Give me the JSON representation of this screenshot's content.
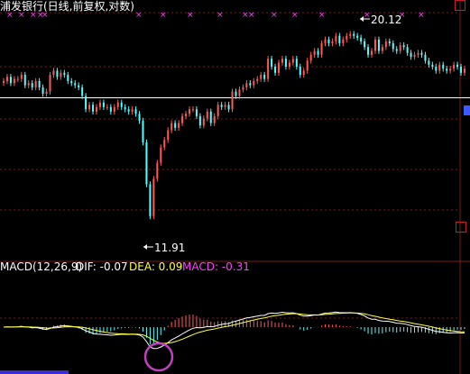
{
  "title": "浦发银行(日线,前复权,对数)",
  "colors": {
    "up": "#ff5a5a",
    "down": "#54ffff",
    "grid": "#7a1a1a",
    "baseline": "#ffffff",
    "dif": "#ffffff",
    "dea": "#ffff40",
    "macd_label": "#ff40ff",
    "marker": "#ff40ff",
    "highlight_circle": "#c040c0"
  },
  "macd_header": {
    "name": "MACD(12,26,9)",
    "dif_label": "DIF: -0.07",
    "dea_label": "DEA: 0.09",
    "macd_label": "MACD: -0.31"
  },
  "price_annotations": {
    "high": "20.12",
    "low": "11.91"
  },
  "chart_data": [
    {
      "type": "candlestick",
      "title": "浦发银行(日线,前复权,对数)",
      "scale": "log",
      "ylim": [
        10.8,
        21.2
      ],
      "annotations": {
        "max": 20.12,
        "min": 11.91
      },
      "reference_line": 16.72,
      "x": [
        1,
        2,
        3,
        4,
        5,
        6,
        7,
        8,
        9,
        10,
        11,
        12,
        13,
        14,
        15,
        16,
        17,
        18,
        19,
        20,
        21,
        22,
        23,
        24,
        25,
        26,
        27,
        28,
        29,
        30,
        31,
        32,
        33,
        34,
        35,
        36,
        37,
        38,
        39,
        40,
        41,
        42,
        43,
        44,
        45,
        46,
        47,
        48,
        49,
        50,
        51,
        52,
        53,
        54,
        55,
        56,
        57,
        58,
        59,
        60,
        61,
        62,
        63,
        64,
        65,
        66,
        67,
        68,
        69,
        70,
        71,
        72,
        73,
        74,
        75,
        76,
        77,
        78,
        79,
        80,
        81,
        82,
        83,
        84,
        85,
        86,
        87,
        88,
        89,
        90,
        91,
        92,
        93,
        94,
        95,
        96,
        97,
        98,
        99,
        100,
        101,
        102,
        103,
        104,
        105,
        106,
        107,
        108,
        109,
        110,
        111,
        112,
        113,
        114,
        115,
        116,
        117,
        118,
        119,
        120,
        121,
        122,
        123,
        124,
        125,
        126,
        127,
        128,
        129,
        130
      ],
      "close": [
        17.5,
        17.7,
        17.4,
        17.6,
        17.6,
        17.8,
        17.3,
        17.4,
        17.2,
        17.5,
        17.2,
        16.9,
        17.0,
        17.8,
        18.0,
        17.7,
        17.9,
        17.8,
        17.5,
        17.4,
        17.3,
        17.2,
        16.8,
        16.2,
        16.4,
        16.1,
        16.3,
        16.5,
        16.3,
        16.3,
        16.1,
        16.3,
        16.5,
        16.3,
        16.2,
        16.1,
        16.2,
        16.0,
        15.7,
        14.8,
        13.2,
        12.1,
        13.4,
        14.0,
        14.6,
        14.9,
        15.3,
        15.6,
        15.4,
        15.6,
        15.9,
        16.0,
        16.2,
        16.2,
        15.9,
        15.5,
        15.8,
        16.1,
        15.6,
        15.9,
        16.4,
        16.3,
        16.4,
        16.2,
        17.0,
        16.8,
        17.1,
        17.2,
        17.4,
        17.3,
        17.5,
        17.6,
        17.8,
        17.6,
        18.6,
        18.2,
        17.9,
        18.4,
        18.6,
        18.2,
        18.4,
        18.6,
        18.2,
        17.8,
        18.0,
        18.5,
        18.8,
        19.0,
        18.8,
        19.4,
        19.6,
        19.4,
        19.5,
        19.8,
        19.4,
        19.6,
        19.8,
        19.9,
        19.8,
        19.7,
        19.5,
        19.2,
        18.8,
        19.0,
        19.6,
        19.0,
        19.2,
        19.5,
        19.4,
        19.1,
        19.0,
        19.3,
        19.2,
        18.9,
        18.7,
        18.8,
        18.9,
        18.8,
        18.5,
        18.3,
        18.2,
        18.0,
        18.3,
        18.1,
        18.0,
        18.1,
        18.3,
        18.2,
        17.9,
        18.1
      ]
    },
    {
      "type": "macd",
      "title": "MACD(12,26,9)",
      "series": [
        {
          "name": "DIF",
          "last": -0.07
        },
        {
          "name": "DEA",
          "last": 0.09
        },
        {
          "name": "MACD",
          "last": -0.31
        }
      ]
    }
  ]
}
